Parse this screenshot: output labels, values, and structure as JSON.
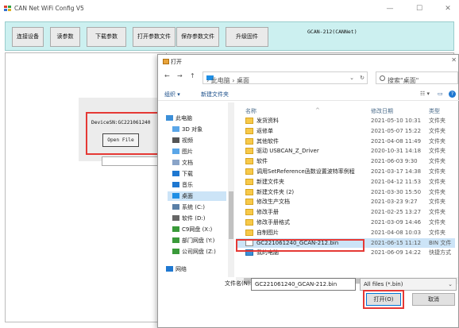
{
  "window": {
    "title": "CAN Net WiFi Config V5",
    "controls": {
      "minimize": "—",
      "maximize": "☐",
      "close": "✕"
    }
  },
  "toolbar": {
    "connect": "连接设备",
    "read_params": "读参数",
    "download_params": "下载参数",
    "open_params_file": "打开参数文件",
    "save_params_file": "保存参数文件",
    "upgrade_firmware": "升级固件",
    "device_model": "GCAN-212(CANNet)"
  },
  "device_panel": {
    "serial": "DeviceSN:GC221061240",
    "open_file_button": "Open File"
  },
  "dialog": {
    "title": "打开",
    "close": "✕",
    "nav": {
      "back": "←",
      "forward": "→",
      "up": "↑",
      "dropdown": "⌄",
      "refresh": "↻"
    },
    "address": {
      "path": "› 此电脑 › 桌面"
    },
    "search_placeholder": "搜索\"桌面\"",
    "commands": {
      "organize": "组织 ▾",
      "new_folder": "新建文件夹",
      "view": "☷ ▾",
      "pane": "▭",
      "help": "?"
    },
    "tree": [
      {
        "label": "此电脑",
        "icon": "pc-icon",
        "color": "#3c8fd8"
      },
      {
        "label": "3D 对象",
        "icon": "cube-icon",
        "color": "#5aa6e8"
      },
      {
        "label": "视频",
        "icon": "video-icon",
        "color": "#555555"
      },
      {
        "label": "图片",
        "icon": "picture-icon",
        "color": "#5aa6e8"
      },
      {
        "label": "文档",
        "icon": "document-icon",
        "color": "#8aa4c8"
      },
      {
        "label": "下载",
        "icon": "download-icon",
        "color": "#1f78d1"
      },
      {
        "label": "音乐",
        "icon": "music-icon",
        "color": "#1f78d1"
      },
      {
        "label": "桌面",
        "icon": "desktop-icon",
        "color": "#1f8fe5",
        "selected": true
      },
      {
        "label": "系统 (C:)",
        "icon": "drive-icon",
        "color": "#5a7fa6"
      },
      {
        "label": "软件 (D:)",
        "icon": "drive-icon",
        "color": "#666666"
      },
      {
        "label": "C9网盘 (X:)",
        "icon": "network-drive-icon",
        "color": "#3a9a3a"
      },
      {
        "label": "部门网盘 (Y:)",
        "icon": "network-drive-icon",
        "color": "#3a9a3a"
      },
      {
        "label": "公司网盘 (Z:)",
        "icon": "network-drive-icon",
        "color": "#3a9a3a"
      },
      {
        "label": "网络",
        "icon": "network-icon",
        "color": "#1f78d1"
      }
    ],
    "columns": {
      "name": "名称",
      "date": "修改日期",
      "type": "类型",
      "sort": "^"
    },
    "files": [
      {
        "name": "发货资料",
        "date": "2021-05-10 10:31",
        "type": "文件夹",
        "kind": "folder"
      },
      {
        "name": "返修单",
        "date": "2021-05-07 15:22",
        "type": "文件夹",
        "kind": "folder"
      },
      {
        "name": "其他软件",
        "date": "2021-04-08 11:49",
        "type": "文件夹",
        "kind": "folder"
      },
      {
        "name": "驱动 USBCAN_Z_Driver",
        "date": "2020-10-31 14:18",
        "type": "文件夹",
        "kind": "folder"
      },
      {
        "name": "软件",
        "date": "2021-06-03 9:30",
        "type": "文件夹",
        "kind": "folder"
      },
      {
        "name": "调用SetReference函数设置波特率例程",
        "date": "2021-03-17 14:38",
        "type": "文件夹",
        "kind": "folder"
      },
      {
        "name": "新建文件夹",
        "date": "2021-04-12 11:53",
        "type": "文件夹",
        "kind": "folder"
      },
      {
        "name": "新建文件夹 (2)",
        "date": "2021-03-30 15:50",
        "type": "文件夹",
        "kind": "folder"
      },
      {
        "name": "修改生产文档",
        "date": "2021-03-23 9:27",
        "type": "文件夹",
        "kind": "folder"
      },
      {
        "name": "修改手册",
        "date": "2021-02-25 13:27",
        "type": "文件夹",
        "kind": "folder"
      },
      {
        "name": "修改手册格式",
        "date": "2021-03-09 14:46",
        "type": "文件夹",
        "kind": "folder"
      },
      {
        "name": "自制图片",
        "date": "2021-04-08 10:03",
        "type": "文件夹",
        "kind": "folder"
      },
      {
        "name": "GC221061240_GCAN-212.bin",
        "date": "2021-06-15 11:12",
        "type": "BIN 文件",
        "kind": "file",
        "selected": true
      },
      {
        "name": "我的电脑",
        "date": "2021-06-09 14:22",
        "type": "快捷方式",
        "kind": "pc"
      }
    ],
    "filename_label": "文件名(N):",
    "filename_value": "GC221061240_GCAN-212.bin",
    "filter": "All files (*.bin)",
    "open_button": "打开(O)",
    "cancel_button": "取消",
    "accent_color": "#0078d7",
    "highlight_color": "#e53935"
  }
}
